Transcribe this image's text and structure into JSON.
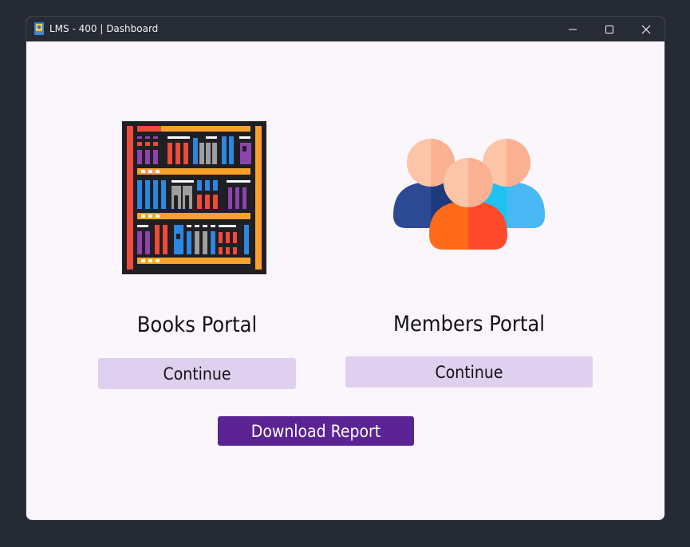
{
  "window": {
    "title": "LMS - 400 | Dashboard",
    "controls": {
      "minimize": "minimize-icon",
      "maximize": "maximize-icon",
      "close": "close-icon"
    }
  },
  "books_portal": {
    "title": "Books Portal",
    "button_label": "Continue",
    "icon": "bookshelf-icon"
  },
  "members_portal": {
    "title": "Members Portal",
    "button_label": "Continue",
    "icon": "members-group-icon"
  },
  "report": {
    "button_label": "Download Report"
  },
  "colors": {
    "window_bg": "#faf6fc",
    "titlebar_bg": "#272b35",
    "continue_bg": "#dfd0ef",
    "report_bg": "#5c2395",
    "desktop_bg": "#262a33"
  }
}
